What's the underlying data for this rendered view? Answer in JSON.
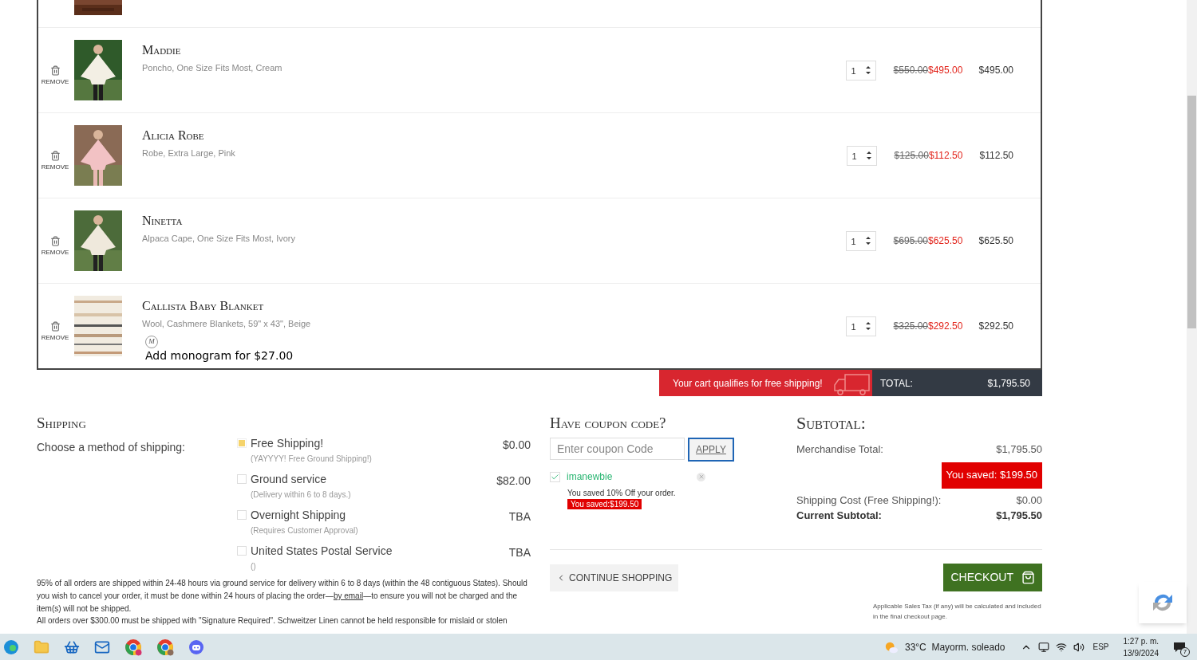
{
  "cart": {
    "items": [
      {
        "remove_label": "REMOVE",
        "name": "Maddie",
        "details": "Poncho, One Size Fits Most, Cream",
        "quantity": "1",
        "original_price": "$550.00",
        "sale_price": "$495.00",
        "total": "$495.00"
      },
      {
        "remove_label": "REMOVE",
        "name": "Alicia Robe",
        "details": "Robe, Extra Large, Pink",
        "quantity": "1",
        "original_price": "$125.00",
        "sale_price": "$112.50",
        "total": "$112.50"
      },
      {
        "remove_label": "REMOVE",
        "name": "Ninetta",
        "details": "Alpaca Cape, One Size Fits Most, Ivory",
        "quantity": "1",
        "original_price": "$695.00",
        "sale_price": "$625.50",
        "total": "$625.50"
      },
      {
        "remove_label": "REMOVE",
        "name": "Callista Baby Blanket",
        "details": "Wool, Cashmere Blankets, 59\" x 43\", Beige",
        "quantity": "1",
        "original_price": "$325.00",
        "sale_price": "$292.50",
        "total": "$292.50",
        "monogram": {
          "icon": "M",
          "label": "Add monogram for $27.00"
        }
      }
    ],
    "free_shipping_banner": "Your cart qualifies for free shipping!",
    "total_label": "TOTAL:",
    "total": "$1,795.50"
  },
  "shipping": {
    "title": "Shipping",
    "prompt": "Choose a method of shipping:",
    "options": [
      {
        "label": "Free Shipping!",
        "note": "(YAYYYY! Free Ground Shipping!)",
        "price": "$0.00",
        "selected": true
      },
      {
        "label": "Ground service",
        "note": "(Delivery within 6 to 8 days.)",
        "price": "$82.00",
        "selected": false
      },
      {
        "label": "Overnight Shipping",
        "note": "(Requires Customer Approval)",
        "price": "TBA",
        "selected": false
      },
      {
        "label": "United States Postal Service",
        "note": "()",
        "price": "TBA",
        "selected": false
      }
    ],
    "notice": {
      "before": "95% of all orders are shipped within 24-48 hours via ground service for delivery within 6 to 8 days (within the 48 contiguous States). Should you wish to cancel your order, it must be done within 24 hours of placing the order—",
      "link": "by email",
      "after": "—to ensure you will not be charged and the item(s) will not be shipped."
    },
    "signature_notice": "All orders over $300.00 must be shipped with \"Signature Required\". Schweitzer Linen cannot be held responsible for mislaid or stolen"
  },
  "coupon": {
    "title": "Have coupon code?",
    "placeholder": "Enter coupon Code",
    "apply": "APPLY",
    "applied": {
      "code": "imanewbie",
      "checked": true,
      "message": "You saved 10% Off your order.",
      "saved": "You saved:$199.50"
    }
  },
  "subtotal": {
    "title": "Subtotal:",
    "merchandise_label": "Merchandise Total:",
    "merchandise": "$1,795.50",
    "saved": "You saved: $199.50",
    "shipping_label": "Shipping Cost (Free Shipping!):",
    "shipping": "$0.00",
    "current_label": "Current Subtotal:",
    "current": "$1,795.50",
    "tax_note": "Applicable Sales Tax (if any) will be calculated and included in the final checkout page."
  },
  "continue_shopping": "CONTINUE SHOPPING",
  "checkout": "CHECKOUT",
  "taskbar": {
    "weather": "33°C  Mayorm. soleado",
    "language": "ESP",
    "time": "1:27 p. m.",
    "date": "13/9/2024",
    "notifications": "7"
  }
}
